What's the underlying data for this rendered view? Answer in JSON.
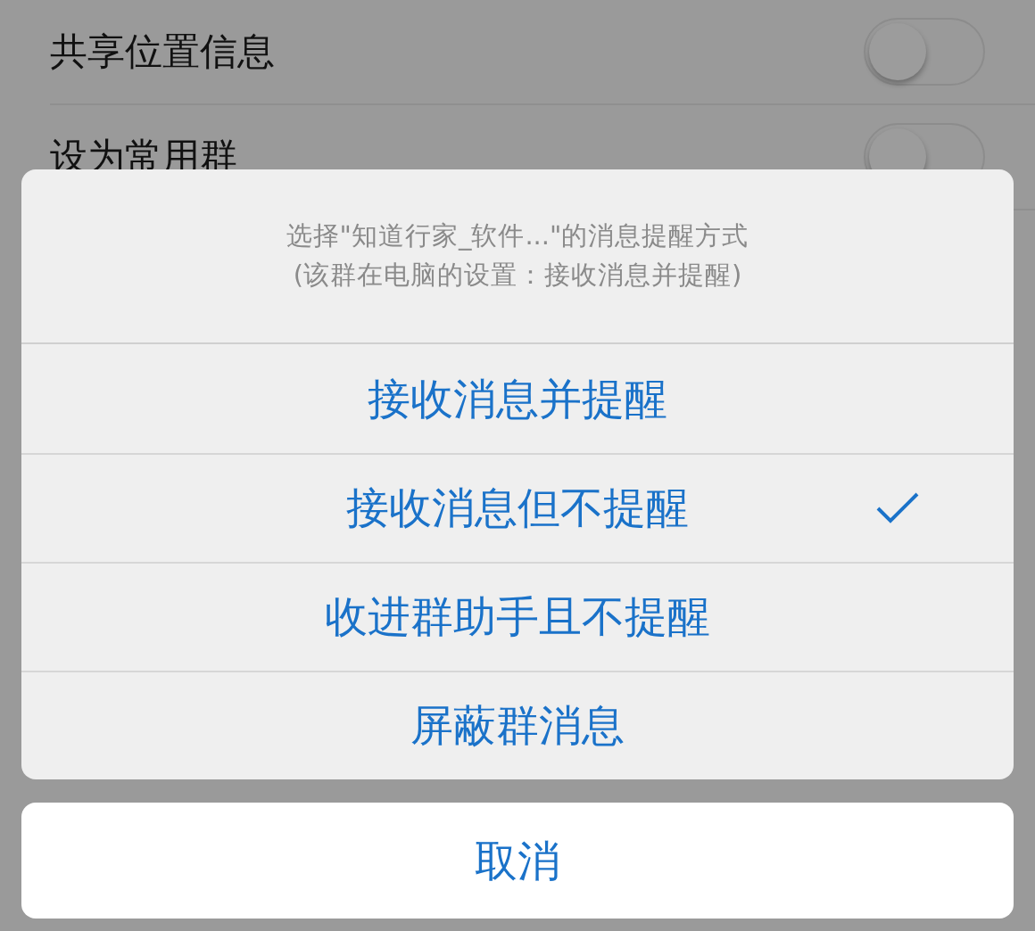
{
  "settings": [
    {
      "label": "共享位置信息",
      "on": false
    },
    {
      "label": "设为常用群",
      "on": false
    }
  ],
  "action_sheet": {
    "title": "选择\"知道行家_软件...\"的消息提醒方式",
    "subtitle": "(该群在电脑的设置：接收消息并提醒)",
    "options": [
      {
        "label": "接收消息并提醒",
        "selected": false
      },
      {
        "label": "接收消息但不提醒",
        "selected": true
      },
      {
        "label": "收进群助手且不提醒",
        "selected": false
      },
      {
        "label": "屏蔽群消息",
        "selected": false
      }
    ],
    "cancel": "取消"
  }
}
